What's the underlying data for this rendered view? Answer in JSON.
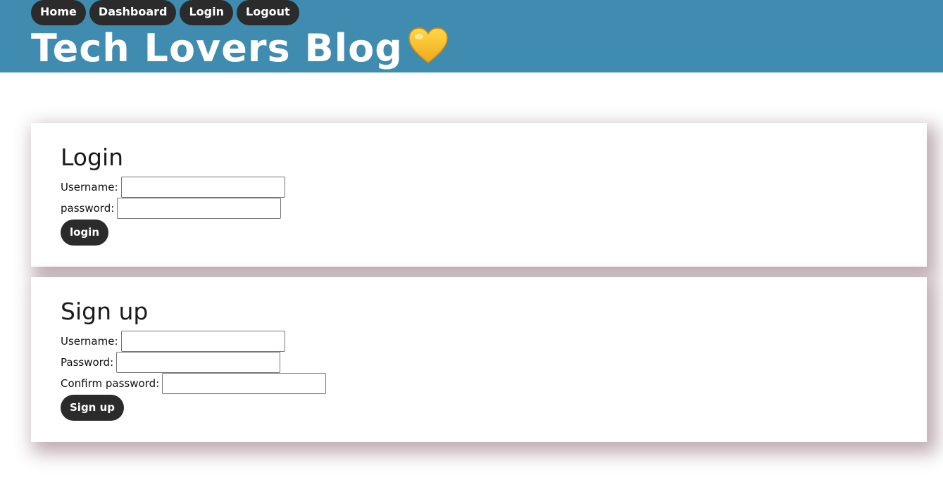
{
  "nav": {
    "items": [
      {
        "label": "Home"
      },
      {
        "label": "Dashboard"
      },
      {
        "label": "Login"
      },
      {
        "label": "Logout"
      }
    ]
  },
  "header": {
    "title": "Tech Lovers Blog",
    "emoji": "yellow-heart-icon"
  },
  "login": {
    "heading": "Login",
    "username_label": "Username:",
    "username_value": "",
    "password_label": "password:",
    "password_value": "",
    "submit_label": "login"
  },
  "signup": {
    "heading": "Sign up",
    "username_label": "Username:",
    "username_value": "",
    "password_label": "Password:",
    "password_value": "",
    "confirm_label": "Confirm password:",
    "confirm_value": "",
    "submit_label": "Sign up"
  },
  "colors": {
    "header_bg": "#3f8cb0",
    "button_bg": "#2b2b2b",
    "heart": "#f7c325"
  }
}
